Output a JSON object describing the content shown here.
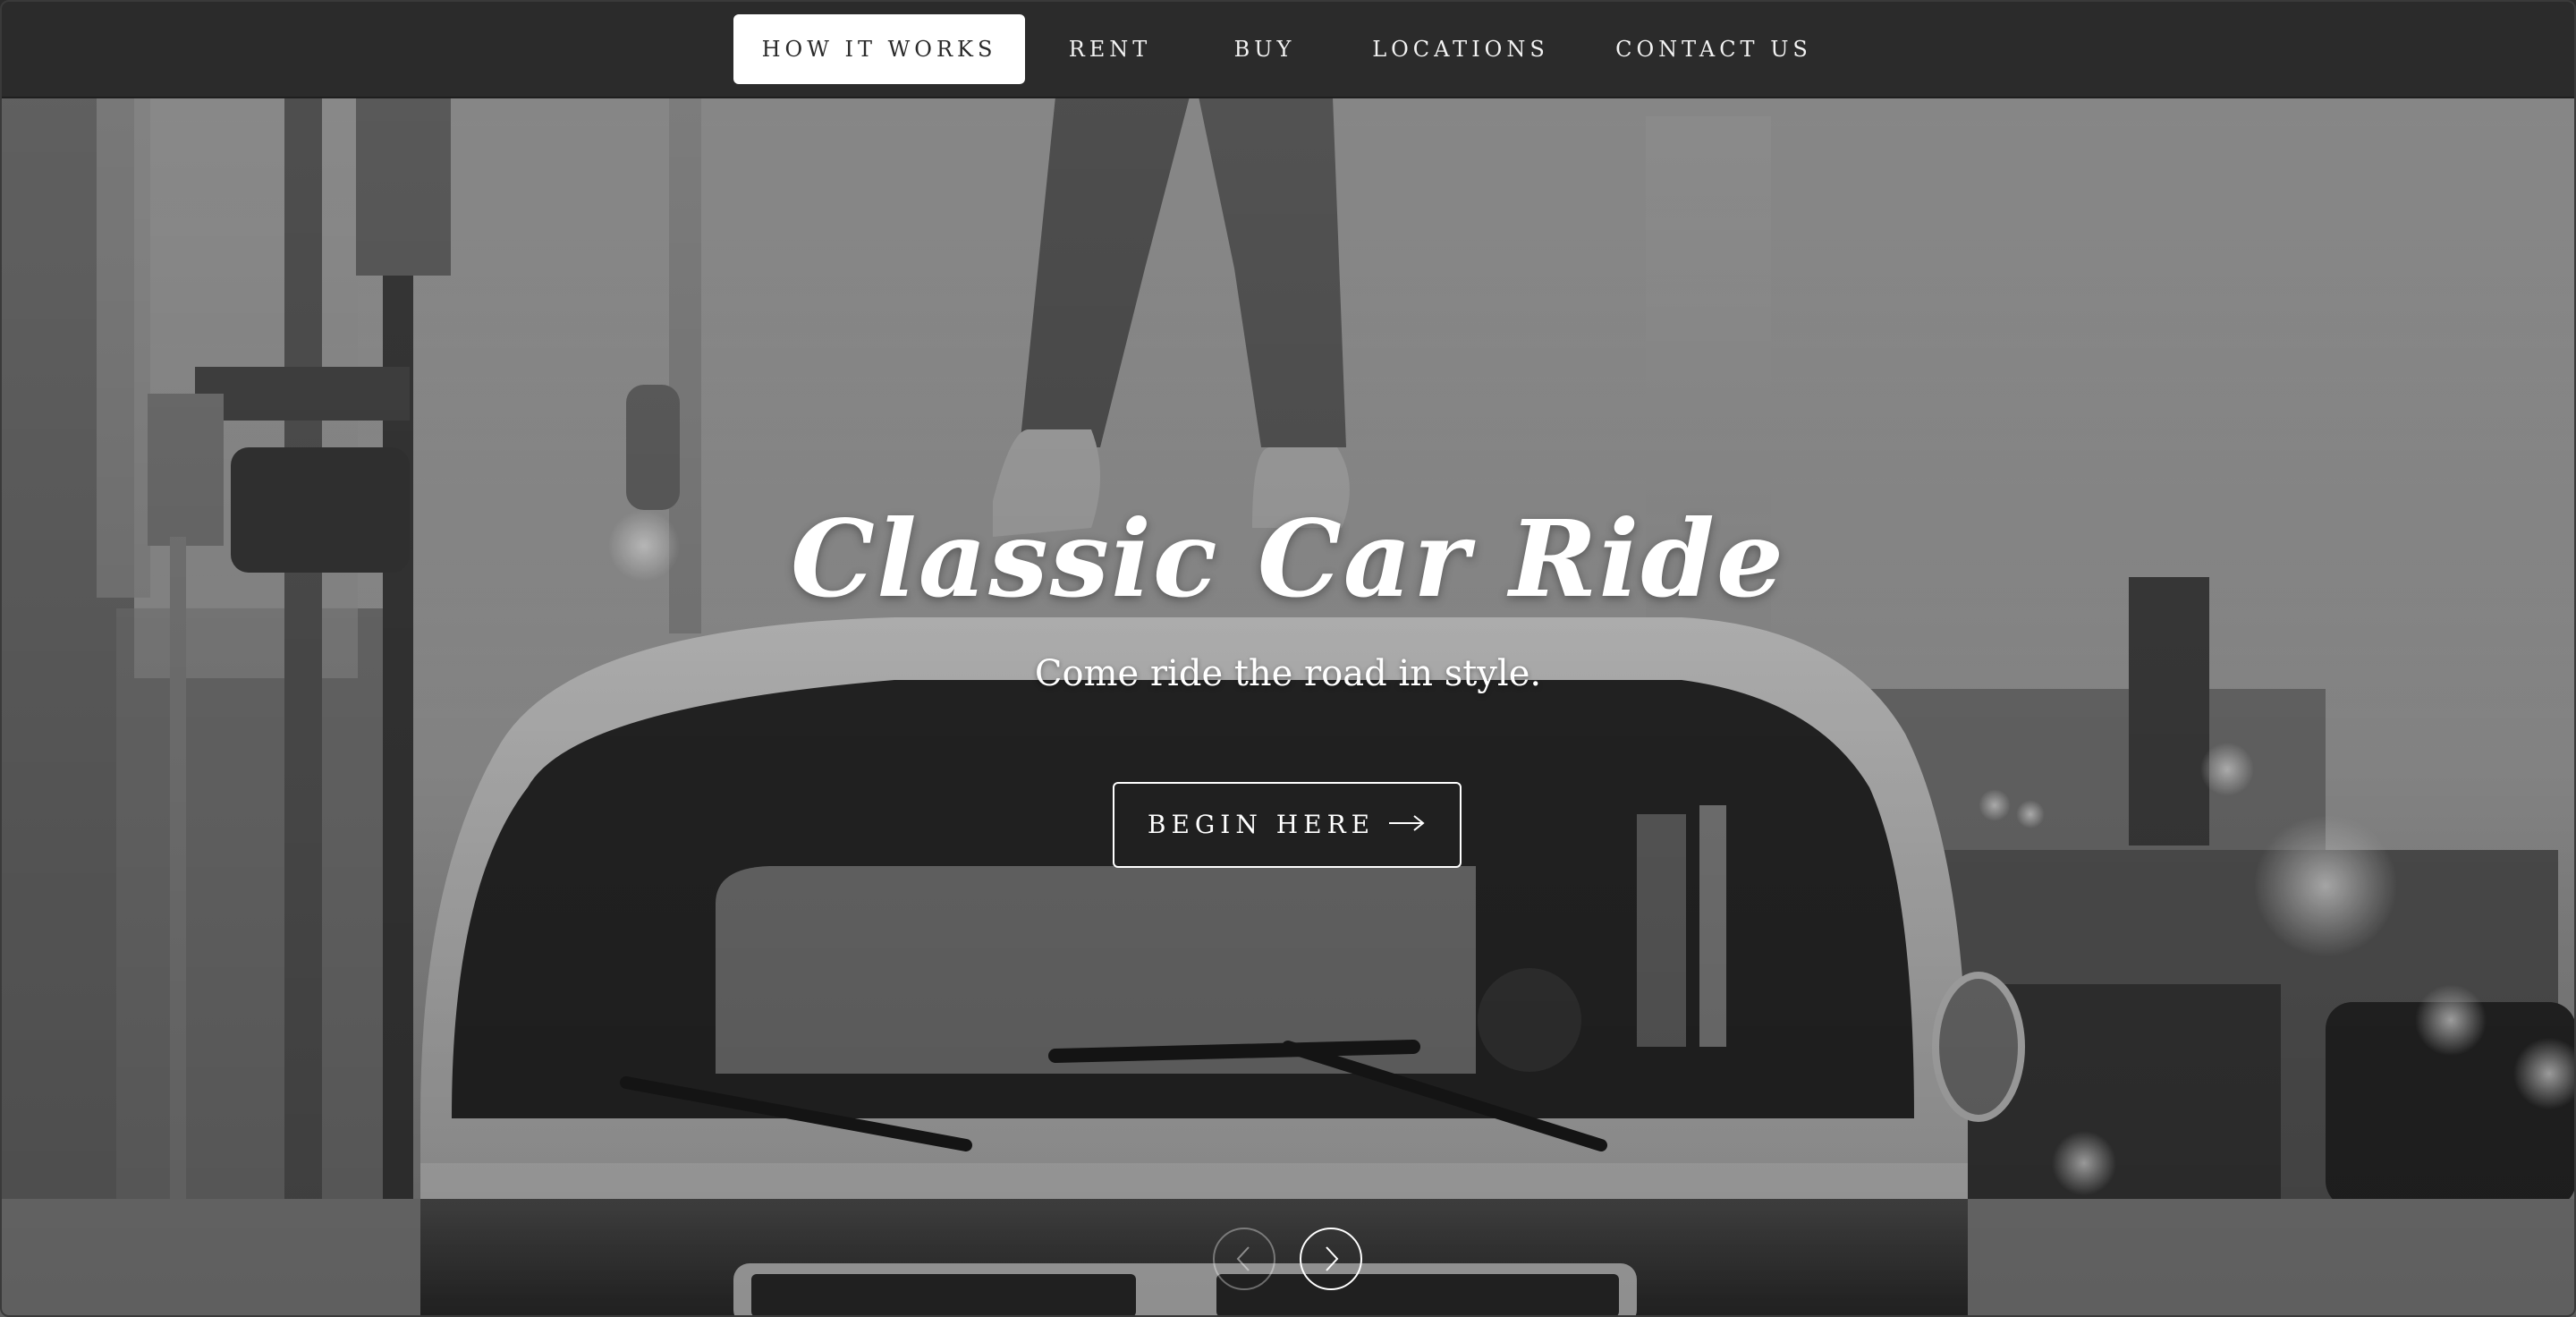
{
  "nav": {
    "items": [
      {
        "label": "HOW IT WORKS",
        "active": true
      },
      {
        "label": "RENT",
        "active": false
      },
      {
        "label": "BUY",
        "active": false
      },
      {
        "label": "LOCATIONS",
        "active": false
      },
      {
        "label": "CONTACT US",
        "active": false
      }
    ]
  },
  "hero": {
    "title": "Classic Car Ride",
    "subtitle": "Come ride the road in style.",
    "cta_label": "BEGIN HERE",
    "cta_icon": "arrow-right-icon",
    "prev_icon": "chevron-left-icon",
    "next_icon": "chevron-right-icon"
  },
  "colors": {
    "nav_bg": "#2b2b2b",
    "active_bg": "#ffffff",
    "text_light": "#ffffff"
  }
}
